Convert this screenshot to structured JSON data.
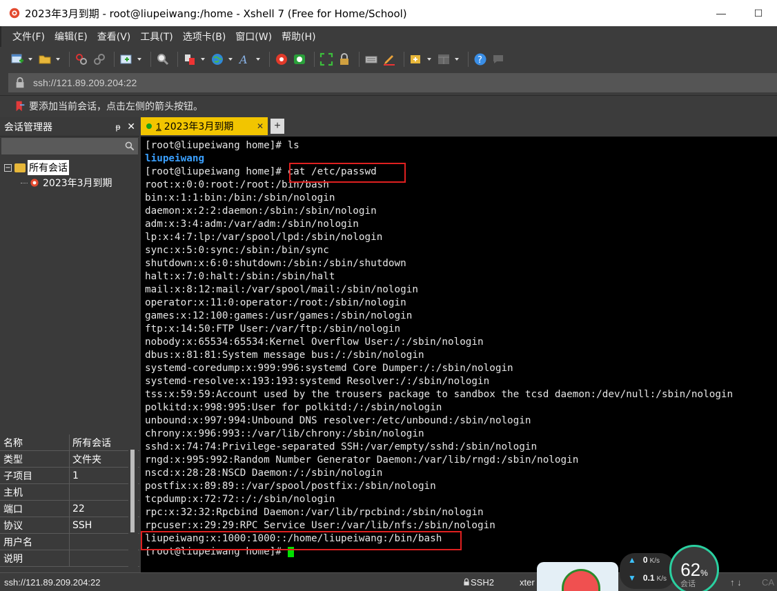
{
  "window": {
    "title": "2023年3月到期 - root@liupeiwang:/home - Xshell 7 (Free for Home/School)",
    "minimize_glyph": "—",
    "maximize_glyph": "☐"
  },
  "menu": [
    "文件(F)",
    "编辑(E)",
    "查看(V)",
    "工具(T)",
    "选项卡(B)",
    "窗口(W)",
    "帮助(H)"
  ],
  "address": {
    "url": "ssh://121.89.209.204:22"
  },
  "hint": "要添加当前会话，点击左侧的箭头按钮。",
  "session_manager": {
    "title": "会话管理器",
    "pin_glyph": "ᵽ",
    "close_glyph": "✕",
    "tree": {
      "root_label": "所有会话",
      "root_expander": "−",
      "child_label": "2023年3月到期"
    },
    "properties": [
      {
        "key": "名称",
        "value": "所有会话"
      },
      {
        "key": "类型",
        "value": "文件夹"
      },
      {
        "key": "子项目",
        "value": "1"
      },
      {
        "key": "主机",
        "value": ""
      },
      {
        "key": "端口",
        "value": "22"
      },
      {
        "key": "协议",
        "value": "SSH"
      },
      {
        "key": "用户名",
        "value": ""
      },
      {
        "key": "说明",
        "value": ""
      }
    ]
  },
  "tab": {
    "number": "1",
    "label": "2023年3月到期",
    "close_glyph": "✕",
    "add_glyph": "+"
  },
  "terminal": {
    "lines": [
      "[root@liupeiwang home]# ls",
      "liupeiwang",
      "[root@liupeiwang home]# cat /etc/passwd",
      "root:x:0:0:root:/root:/bin/bash",
      "bin:x:1:1:bin:/bin:/sbin/nologin",
      "daemon:x:2:2:daemon:/sbin:/sbin/nologin",
      "adm:x:3:4:adm:/var/adm:/sbin/nologin",
      "lp:x:4:7:lp:/var/spool/lpd:/sbin/nologin",
      "sync:x:5:0:sync:/sbin:/bin/sync",
      "shutdown:x:6:0:shutdown:/sbin:/sbin/shutdown",
      "halt:x:7:0:halt:/sbin:/sbin/halt",
      "mail:x:8:12:mail:/var/spool/mail:/sbin/nologin",
      "operator:x:11:0:operator:/root:/sbin/nologin",
      "games:x:12:100:games:/usr/games:/sbin/nologin",
      "ftp:x:14:50:FTP User:/var/ftp:/sbin/nologin",
      "nobody:x:65534:65534:Kernel Overflow User:/:/sbin/nologin",
      "dbus:x:81:81:System message bus:/:/sbin/nologin",
      "systemd-coredump:x:999:996:systemd Core Dumper:/:/sbin/nologin",
      "systemd-resolve:x:193:193:systemd Resolver:/:/sbin/nologin",
      "tss:x:59:59:Account used by the trousers package to sandbox the tcsd daemon:/dev/null:/sbin/nologin",
      "polkitd:x:998:995:User for polkitd:/:/sbin/nologin",
      "unbound:x:997:994:Unbound DNS resolver:/etc/unbound:/sbin/nologin",
      "chrony:x:996:993::/var/lib/chrony:/sbin/nologin",
      "sshd:x:74:74:Privilege-separated SSH:/var/empty/sshd:/sbin/nologin",
      "rngd:x:995:992:Random Number Generator Daemon:/var/lib/rngd:/sbin/nologin",
      "nscd:x:28:28:NSCD Daemon:/:/sbin/nologin",
      "postfix:x:89:89::/var/spool/postfix:/sbin/nologin",
      "tcpdump:x:72:72::/:/sbin/nologin",
      "rpc:x:32:32:Rpcbind Daemon:/var/lib/rpcbind:/sbin/nologin",
      "rpcuser:x:29:29:RPC Service User:/var/lib/nfs:/sbin/nologin",
      "liupeiwang:x:1000:1000::/home/liupeiwang:/bin/bash",
      "[root@liupeiwang home]# "
    ]
  },
  "status": {
    "address": "ssh://121.89.209.204:22",
    "protocol": "SSH2",
    "terminal": "xter",
    "arrows": "↑ ↓",
    "caps": "CA"
  },
  "net_widget": {
    "up_value": "0",
    "up_unit": "K/s",
    "down_value": "0.1",
    "down_unit": "K/s",
    "up_arrow": "▲",
    "down_arrow": "▼",
    "percent": "62",
    "percent_sign": "%",
    "percent_label": "会话"
  },
  "colors": {
    "tab_active": "#f2c500",
    "terminal_bg": "#000000",
    "highlight_box": "#e02020",
    "dir_color": "#3aa0ff",
    "cursor": "#00e000"
  }
}
